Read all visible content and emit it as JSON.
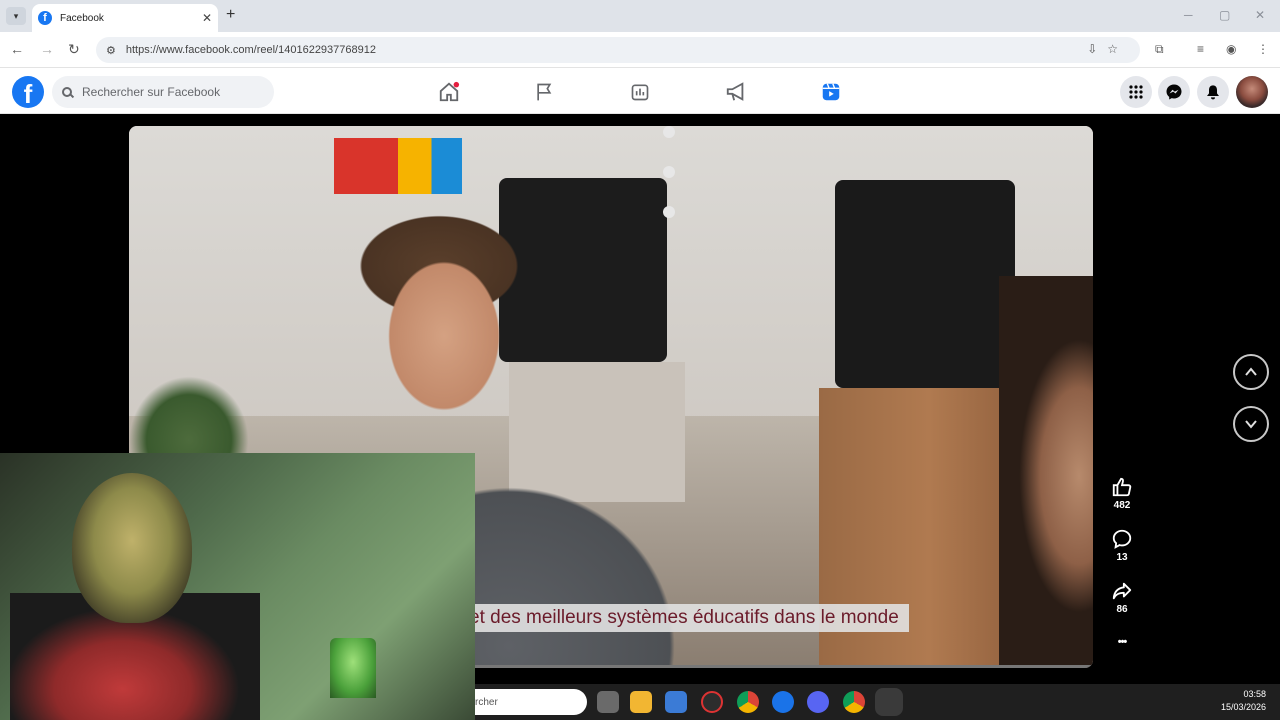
{
  "browser": {
    "tab_title": "Facebook",
    "tab_favicon": "f",
    "new_tab_label": "+",
    "tab_close": "✕",
    "url": "https://www.facebook.com/reel/1401622937768912",
    "window_controls": [
      "─",
      "▢",
      "✕"
    ]
  },
  "facebook": {
    "logo_letter": "f",
    "search_placeholder": "Rechercher sur Facebook",
    "nav_items": [
      "home-icon",
      "flag-icon",
      "gaming-icon",
      "megaphone-icon",
      "reels-icon"
    ],
    "active_nav": "reels-icon",
    "brand_color": "#1877f2"
  },
  "reel": {
    "subtitle": "et des meilleurs systèmes éducatifs dans le monde",
    "likes": "482",
    "comments": "13",
    "shares": "86",
    "more_label": "•••"
  },
  "taskbar": {
    "search_text": "rcher",
    "time": "03:58",
    "date": "15/03/2026"
  }
}
